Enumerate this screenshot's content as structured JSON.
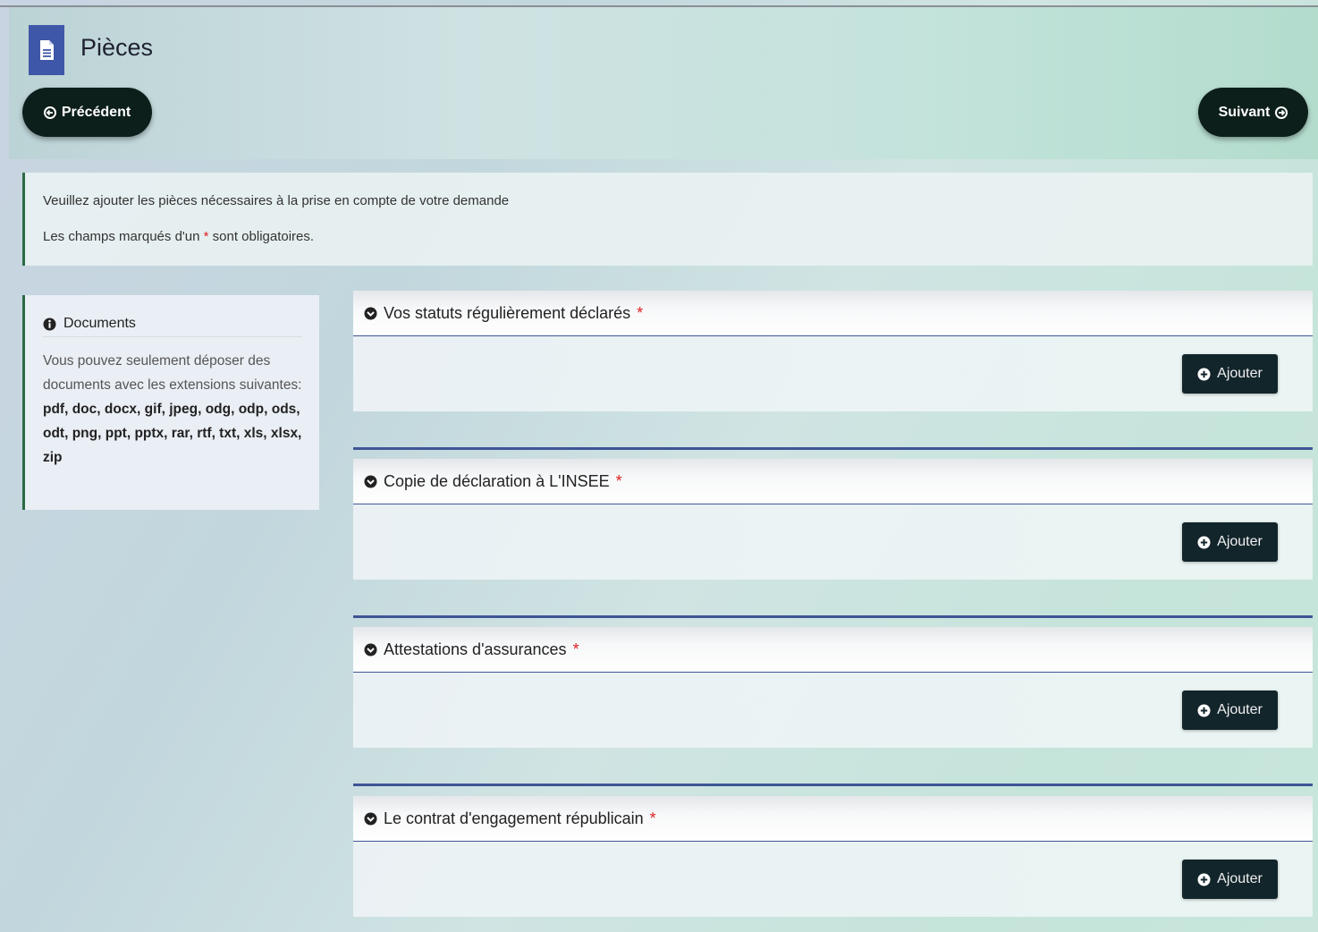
{
  "header": {
    "title": "Pièces",
    "prev_label": "Précédent",
    "next_label": "Suivant"
  },
  "info": {
    "line1": "Veuillez ajouter les pièces nécessaires à la prise en compte de votre demande",
    "line2_before": "Les champs marqués d'un",
    "required_mark": "*",
    "line2_after": "sont obligatoires."
  },
  "documents": {
    "heading": "Documents",
    "description": "Vous pouvez seulement déposer des documents avec les extensions suivantes:",
    "extensions": "pdf, doc, docx, gif, jpeg, odg, odp, ods, odt, png, ppt, pptx, rar, rtf, txt, xls, xlsx, zip"
  },
  "sections": [
    {
      "title": "Vos statuts régulièrement déclarés",
      "required": "*",
      "add_label": "Ajouter"
    },
    {
      "title": "Copie de déclaration à L'INSEE",
      "required": "*",
      "add_label": "Ajouter"
    },
    {
      "title": "Attestations d'assurances",
      "required": "*",
      "add_label": "Ajouter"
    },
    {
      "title": "Le contrat d'engagement républicain",
      "required": "*",
      "add_label": "Ajouter"
    }
  ],
  "icons": {
    "title": "document-icon",
    "prev": "arrow-circle-left-icon",
    "next": "arrow-circle-right-icon",
    "info": "info-circle-icon",
    "collapse": "chevron-circle-down-icon",
    "add": "plus-circle-icon"
  },
  "colors": {
    "accent_blue": "#3f57a8",
    "dark_button": "#0c1f1a",
    "add_button": "#12252b",
    "required": "#dd2222",
    "border_green": "#2b6a45"
  }
}
